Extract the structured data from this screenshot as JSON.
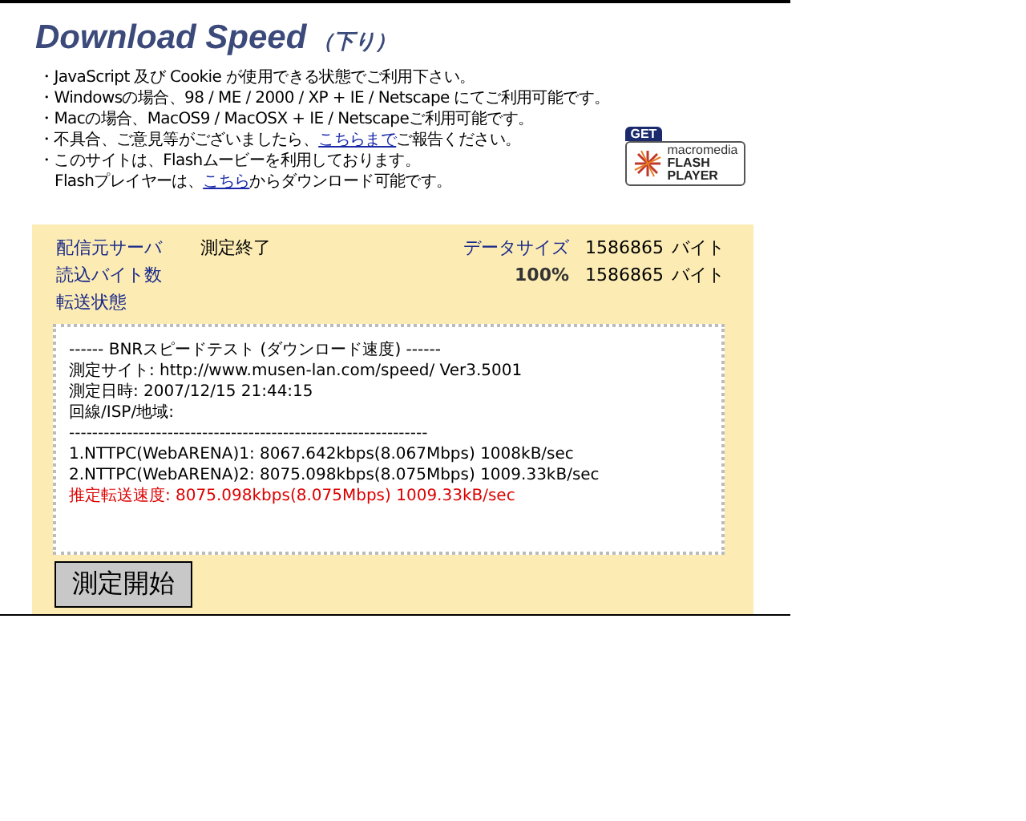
{
  "header": {
    "title": "Download Speed",
    "subtitle": "（下り）"
  },
  "notes": [
    {
      "segments": [
        {
          "text": "・JavaScript 及び Cookie が使用できる状態でご利用下さい。",
          "link": false
        }
      ]
    },
    {
      "segments": [
        {
          "text": "・Windowsの場合、98 / ME / 2000 / XP + IE / Netscape にてご利用可能です。",
          "link": false
        }
      ]
    },
    {
      "segments": [
        {
          "text": "・Macの場合、MacOS9 / MacOSX + IE / Netscapeご利用可能です。",
          "link": false
        }
      ]
    },
    {
      "segments": [
        {
          "text": "・不具合、ご意見等がございましたら、",
          "link": false
        },
        {
          "text": "こちらまで",
          "link": true
        },
        {
          "text": "ご報告ください。",
          "link": false
        }
      ]
    },
    {
      "segments": [
        {
          "text": "・このサイトは、Flashムービーを利用しております。",
          "link": false
        }
      ]
    },
    {
      "segments": [
        {
          "text": "Flashプレイヤーは、",
          "link": false
        },
        {
          "text": "こちら",
          "link": true
        },
        {
          "text": "からダウンロード可能です。",
          "link": false
        }
      ]
    }
  ],
  "flash_badge": {
    "get": "GET",
    "brand": "macromedia",
    "line1": "FLASH",
    "line2": "PLAYER"
  },
  "status": {
    "server_label": "配信元サーバ",
    "server_value": "測定終了",
    "size_label": "データサイズ",
    "size_value": "1586865",
    "size_unit": "バイト",
    "read_label": "読込バイト数",
    "read_percent": "100%",
    "read_value": "1586865",
    "read_unit": "バイト",
    "transfer_label": "転送状態"
  },
  "results": [
    {
      "text": "------ BNRスピードテスト (ダウンロード速度) ------",
      "highlight": false
    },
    {
      "text": "測定サイト: http://www.musen-lan.com/speed/ Ver3.5001",
      "highlight": false
    },
    {
      "text": "測定日時: 2007/12/15 21:44:15",
      "highlight": false
    },
    {
      "text": "回線/ISP/地域:",
      "highlight": false
    },
    {
      "text": "--------------------------------------------------------------",
      "highlight": false
    },
    {
      "text": "1.NTTPC(WebARENA)1: 8067.642kbps(8.067Mbps) 1008kB/sec",
      "highlight": false
    },
    {
      "text": "2.NTTPC(WebARENA)2: 8075.098kbps(8.075Mbps) 1009.33kB/sec",
      "highlight": false
    },
    {
      "text": "推定転送速度: 8075.098kbps(8.075Mbps) 1009.33kB/sec",
      "highlight": true
    }
  ],
  "start_button": "測定開始"
}
